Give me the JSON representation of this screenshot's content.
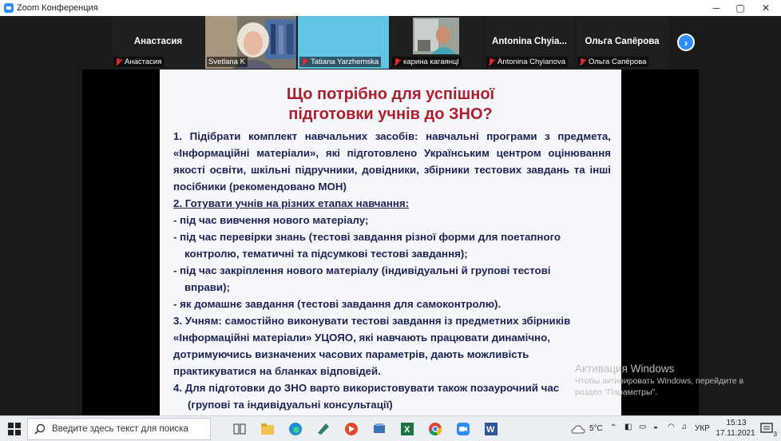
{
  "window": {
    "title": "Zoom Конференция",
    "minimize_glyph": "─",
    "maximize_glyph": "▢",
    "close_glyph": "✕"
  },
  "participants": [
    {
      "name": "Анастасия",
      "caption": "Анастасия",
      "video": false,
      "muted": true
    },
    {
      "name": "Svetlana K",
      "caption": "Svetlana K",
      "video": true,
      "muted": false
    },
    {
      "name": "Tatiana Yarzhemska",
      "caption": "Tatiana Yarzhemska",
      "video": false,
      "muted": true
    },
    {
      "name": "карина кагаянц",
      "caption": "карина кагаянцl",
      "video": true,
      "muted": true
    },
    {
      "name": "Antonina Chyia...",
      "caption": "Antonina Chyianova",
      "video": false,
      "muted": true
    },
    {
      "name": "Ольга Сапёрова",
      "caption": "Ольга Сапёрова",
      "video": false,
      "muted": true
    }
  ],
  "next_page_glyph": "›",
  "slide": {
    "title_line1": "Що потрібно для успішної",
    "title_line2": "підготовки учнів до ЗНО?",
    "item1": "1. Підібрати комплект навчальних засобів: навчальні програми з предмета, «Інформаційні матеріали», які підготовлено Українським центром оцінювання якості освіти, шкільні підручники, довідники, збірники тестових завдань та інші посібники (рекомендовано МОН)",
    "item2": "2. Готувати учнів на різних етапах навчання:",
    "bullet1": "- під час вивчення нового матеріалу;",
    "bullet2a": "- під час перевірки знань (тестові завдання різної форми для поетапного",
    "bullet2b": "контролю, тематичні та підсумкові тестові завдання);",
    "bullet3a": "- під час закріплення нового матеріалу (індивідуальні й групові тестові",
    "bullet3b": "вправи);",
    "bullet4": "- як домашнє завдання (тестові завдання для самоконтролю).",
    "item3a": "3. Учням: самостійно виконувати тестові завдання із предметних збірників",
    "item3b": "«Інформаційні матеріали» УЦОЯО, які навчають працювати динамічно,",
    "item3c": "дотримуючись визначених часових параметрів, дають можливість",
    "item3d": "практикуватися на бланках відповідей.",
    "item4a": "4. Для підготовки до ЗНО варто використовувати також позаурочний час",
    "item4b": "(групові та індивідуальні консультації)"
  },
  "activation": {
    "title": "Активация Windows",
    "line1": "Чтобы активировать Windows, перейдите в",
    "line2": "раздел \"Параметры\"."
  },
  "taskbar": {
    "search_placeholder": "Введите здесь текст для поиска",
    "weather": "5°C",
    "language": "УКР",
    "time": "15:13",
    "date": "17.11.2021",
    "notification_count": "3"
  },
  "colors": {
    "slide_title": "#b01e2c",
    "slide_text": "#1c2354",
    "zoom_blue": "#2d8cff",
    "highlight_tile": "#62c4e5"
  }
}
